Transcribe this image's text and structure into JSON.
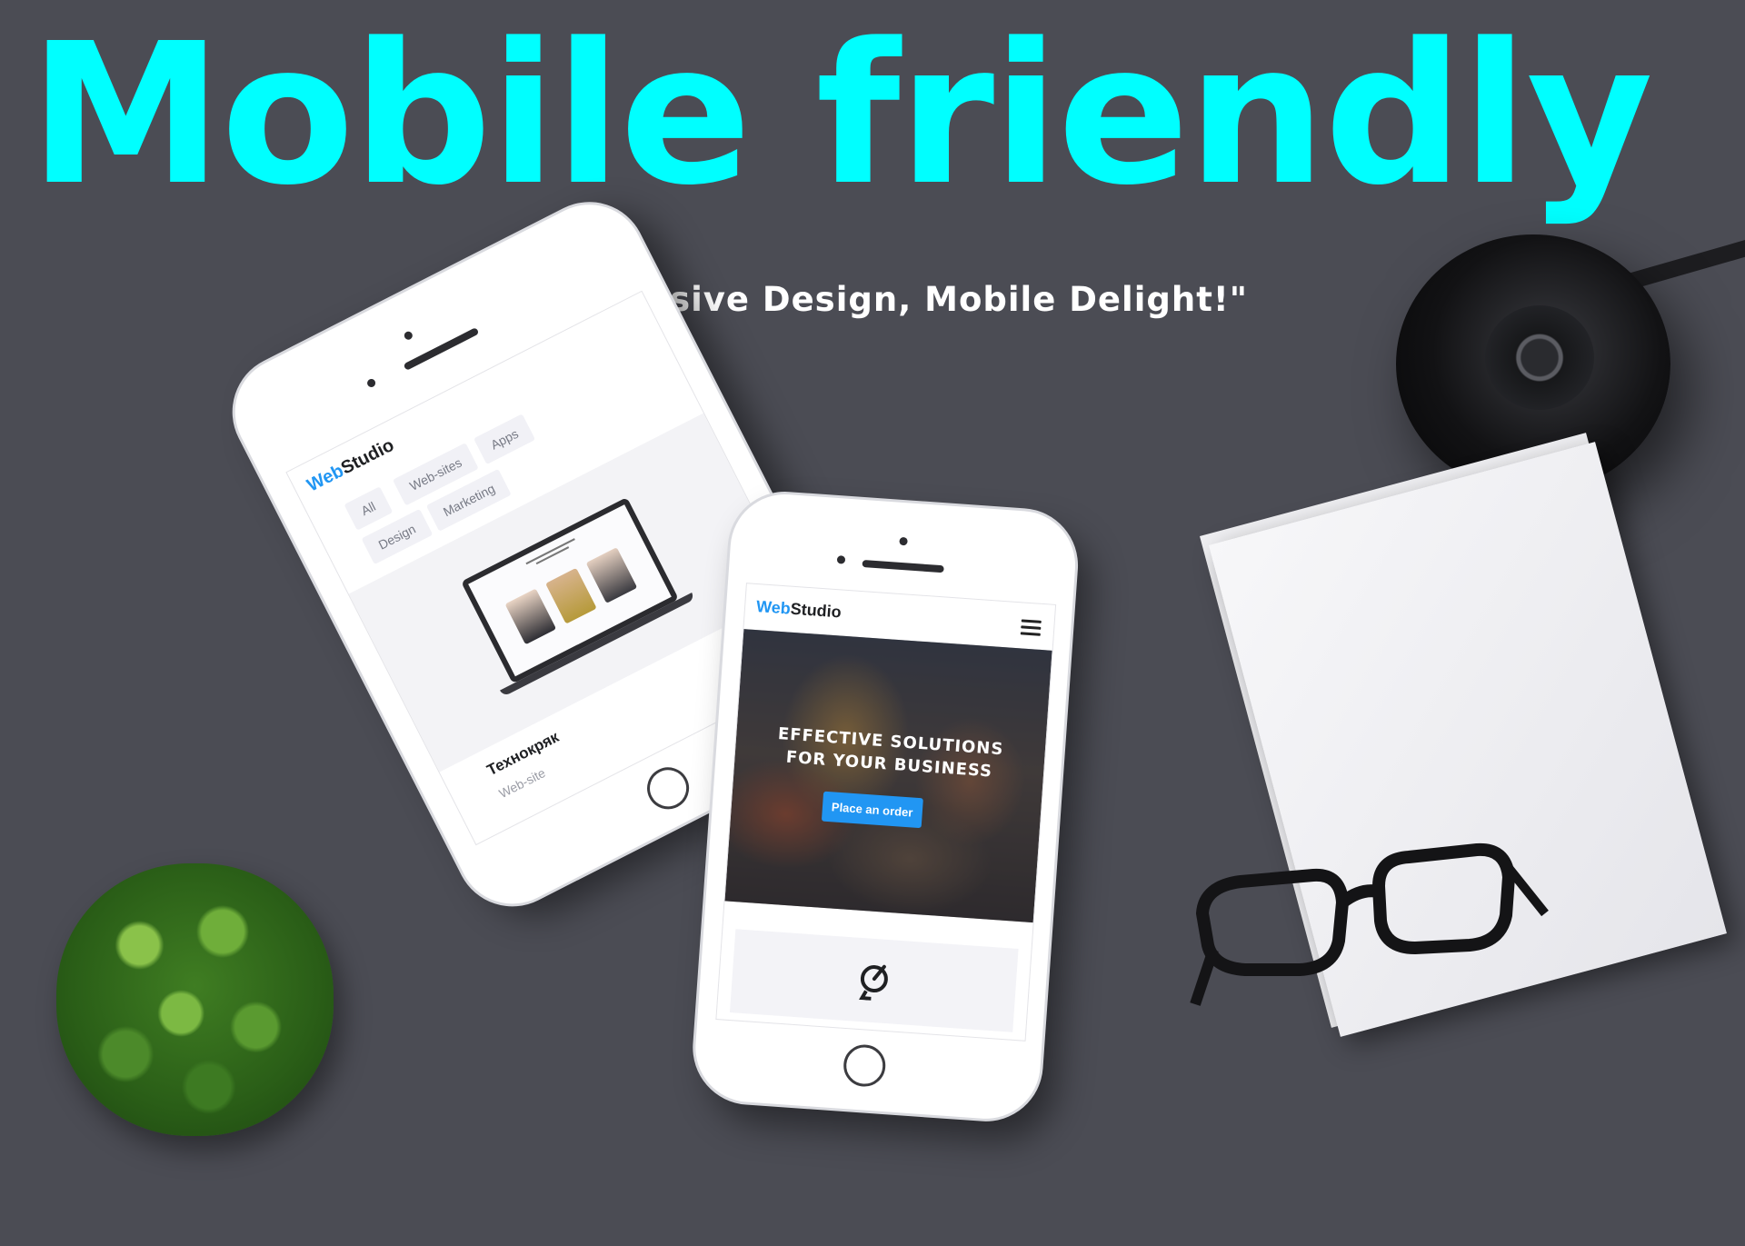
{
  "headline": "Mobile friendly",
  "tagline": "\"Responsive Design, Mobile Delight!\"",
  "colors": {
    "headline": "#00ffff",
    "background": "#4b4c54",
    "brand_accent": "#2196f3"
  },
  "phone_left": {
    "logo_part1": "Web",
    "logo_part2": "Studio",
    "menu_icon": "hamburger-menu-icon",
    "filters": [
      "All",
      "Web-sites",
      "Apps",
      "Design",
      "Marketing"
    ],
    "project_title": "Технокряк",
    "project_subtitle": "Web-site"
  },
  "phone_center": {
    "logo_part1": "Web",
    "logo_part2": "Studio",
    "menu_icon": "hamburger-menu-icon",
    "hero_line1": "EFFECTIVE SOLUTIONS",
    "hero_line2": "FOR YOUR BUSINESS",
    "order_button": "Place an order",
    "feature_icon": "strategy-icon"
  }
}
